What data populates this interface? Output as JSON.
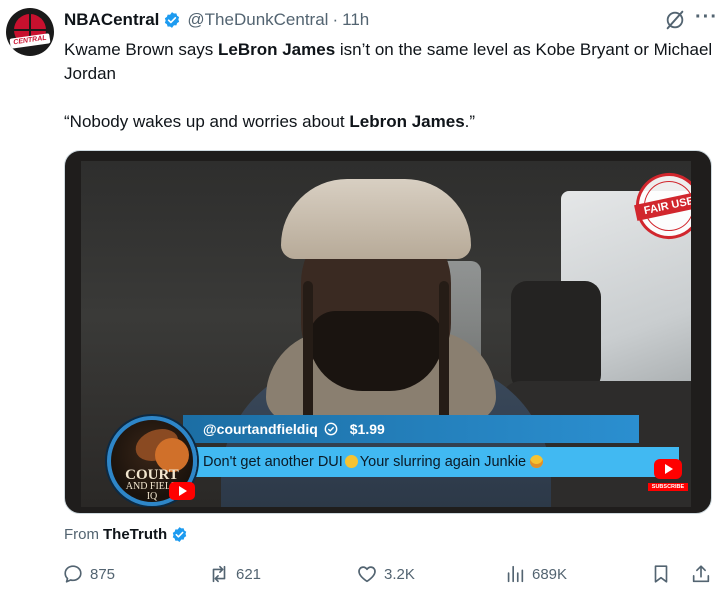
{
  "account": {
    "name": "NBACentral",
    "handle": "@TheDunkCentral",
    "separator": "·",
    "time": "11h",
    "avatar_text": "CENTRAL"
  },
  "post": {
    "line1_pre": "Kwame Brown says ",
    "line1_bold": "LeBron James",
    "line1_post": " isn’t on the same level as Kobe Bryant or Michael Jordan",
    "line2_pre": "“Nobody wakes up and worries about ",
    "line2_bold": "Lebron James",
    "line2_post": ".”"
  },
  "media": {
    "stamp_text": "FAIR USE",
    "logo_line1": "COURT",
    "logo_line2": "AND FIELD",
    "logo_line3": "IQ",
    "superchat_user": "@courtandfieldiq",
    "superchat_amount": "$1.99",
    "superchat_msg_a": "Don't get another DUI",
    "superchat_msg_b": "Your slurring again Junkie",
    "subscribe_label": "SUBSCRIBE"
  },
  "attribution": {
    "label": "From",
    "source": "TheTruth"
  },
  "actions": {
    "replies": "875",
    "reposts": "621",
    "likes": "3.2K",
    "views": "689K"
  },
  "icons": {
    "verified": "verified-badge-icon",
    "grok": "grok-icon",
    "more": "more-icon",
    "reply": "reply-icon",
    "repost": "repost-icon",
    "like": "heart-icon",
    "views": "views-icon",
    "bookmark": "bookmark-icon",
    "share": "share-icon"
  },
  "colors": {
    "verified": "#1d9bf0",
    "muted": "#536471",
    "text": "#0f1419",
    "superchat_top": "#2b8fd0",
    "superchat_bottom": "#41b9f2"
  }
}
